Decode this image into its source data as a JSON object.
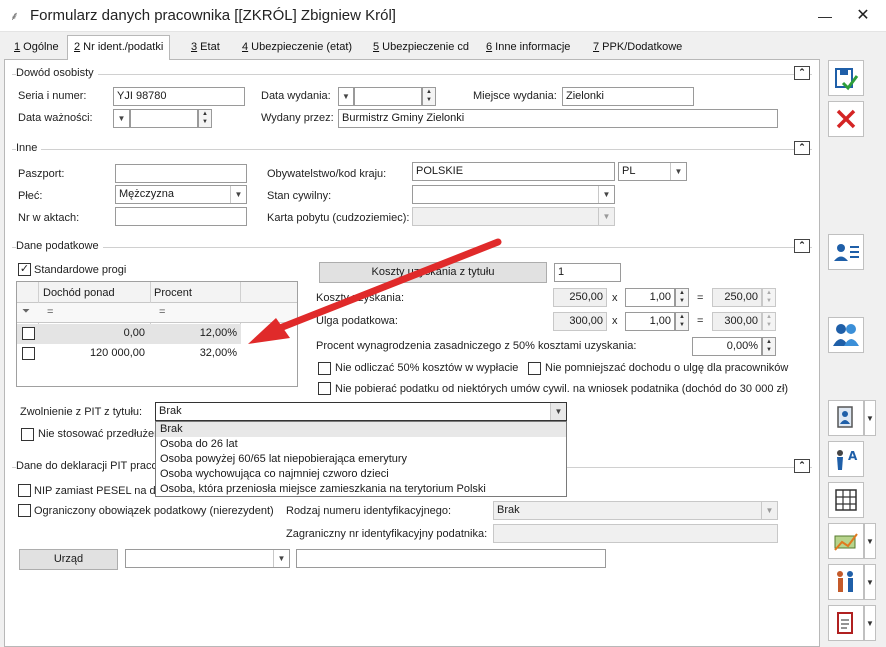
{
  "window": {
    "title": "Formularz danych pracownika [[ZKRÓL] Zbigniew Król]"
  },
  "tabs": [
    {
      "key": "1",
      "label": " Ogólne"
    },
    {
      "key": "2",
      "label": " Nr ident./podatki"
    },
    {
      "key": "3",
      "label": " Etat"
    },
    {
      "key": "4",
      "label": " Ubezpieczenie (etat)"
    },
    {
      "key": "5",
      "label": " Ubezpieczenie cd"
    },
    {
      "key": "6",
      "label": " Inne informacje"
    },
    {
      "key": "7",
      "label": " PPK/Dodatkowe"
    }
  ],
  "dowod": {
    "title": "Dowód osobisty",
    "seria_label": "Seria i numer:",
    "seria_value": "YJI 98780",
    "data_wydania_label": "Data wydania:",
    "miejsce_label": "Miejsce wydania:",
    "miejsce_value": "Zielonki",
    "waznosc_label": "Data ważności:",
    "wydany_label": "Wydany przez:",
    "wydany_value": "Burmistrz Gminy Zielonki"
  },
  "inne": {
    "title": "Inne",
    "paszport_label": "Paszport:",
    "plec_label": "Płeć:",
    "plec_value": "Mężczyzna",
    "nr_akt_label": "Nr w aktach:",
    "obyw_label": "Obywatelstwo/kod kraju:",
    "obyw_value": "POLSKIE",
    "kod_value": "PL",
    "stan_label": "Stan cywilny:",
    "karta_label": "Karta pobytu (cudzoziemiec):"
  },
  "podatkowe": {
    "title": "Dane podatkowe",
    "standard_label": "Standardowe progi",
    "grid_headers": [
      "Dochód ponad",
      "Procent"
    ],
    "filter_symbols": [
      "=",
      "="
    ],
    "rows": [
      {
        "dochod": "0,00",
        "procent": "12,00%"
      },
      {
        "dochod": "120 000,00",
        "procent": "32,00%"
      }
    ],
    "koszty_button": "Koszty uzyskania z tytułu",
    "koszty_count": "1",
    "koszty_label": "Koszty uzyskania:",
    "koszty_value": "250,00",
    "koszty_mult": "1,00",
    "koszty_result": "250,00",
    "ulga_label": "Ulga podatkowa:",
    "ulga_value": "300,00",
    "ulga_mult": "1,00",
    "ulga_result": "300,00",
    "times": "x",
    "equals": "=",
    "procent_label": "Procent wynagrodzenia zasadniczego z 50% kosztami uzyskania:",
    "procent_value": "0,00%",
    "nie_odliczac": "Nie odliczać 50% kosztów w wypłacie",
    "nie_pomniejszac": "Nie pomniejszać dochodu o ulgę dla pracowników",
    "nie_pobierac": "Nie pobierać podatku od niektórych umów cywil. na wniosek podatnika (dochód do 30 000 zł)",
    "zwolnienie_label": "Zwolnienie z PIT z tytułu:",
    "zwolnienie_value": "Brak",
    "nie_stosowac": "Nie stosować przedłużen",
    "dropdown_options": [
      "Brak",
      "Osoba do 26 lat",
      "Osoba powyżej 60/65 lat niepobierająca emerytury",
      "Osoba wychowująca co najmniej czworo dzieci",
      "Osoba, która przeniosła miejsce zamieszkania na terytorium Polski"
    ]
  },
  "deklaracje": {
    "title": "Dane do deklaracji PIT praco",
    "nip_label": "NIP zamiast PESEL na dek",
    "ograniczony_label": "Ograniczony obowiązek podatkowy (nierezydent)",
    "rodzaj_label": "Rodzaj numeru identyfikacyjnego:",
    "rodzaj_value": "Brak",
    "zagraniczny_label": "Zagraniczny nr identyfikacyjny podatnika:",
    "urzad_button": "Urząd"
  },
  "colors": {
    "arrow": "#e02a2a",
    "accent": "#1f5fa8"
  }
}
